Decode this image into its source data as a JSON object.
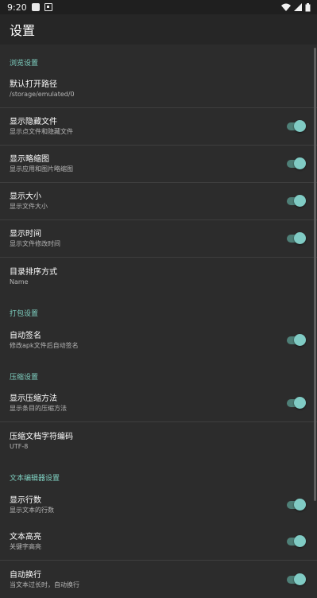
{
  "status_bar": {
    "time": "9:20",
    "icons": [
      "app-icon",
      "a-notification-icon",
      "wifi-icon",
      "cellular-icon",
      "battery-icon"
    ]
  },
  "app_bar": {
    "title": "设置"
  },
  "sections": {
    "browse": {
      "header": "浏览设置",
      "items": [
        {
          "title": "默认打开路径",
          "subtitle": "/storage/emulated/0"
        },
        {
          "title": "显示隐藏文件",
          "subtitle": "显示点文件和隐藏文件",
          "toggle": true
        },
        {
          "title": "显示略缩图",
          "subtitle": "显示应用和图片略缩图",
          "toggle": true
        },
        {
          "title": "显示大小",
          "subtitle": "显示文件大小",
          "toggle": true
        },
        {
          "title": "显示时间",
          "subtitle": "显示文件修改时间",
          "toggle": true
        },
        {
          "title": "目录排序方式",
          "subtitle": "Name"
        }
      ]
    },
    "package": {
      "header": "打包设置",
      "items": [
        {
          "title": "自动签名",
          "subtitle": "修改apk文件后自动签名",
          "toggle": true
        }
      ]
    },
    "compress": {
      "header": "压缩设置",
      "items": [
        {
          "title": "显示压缩方法",
          "subtitle": "显示条目的压缩方法",
          "toggle": true
        },
        {
          "title": "压缩文档字符编码",
          "subtitle": "UTF-8"
        }
      ]
    },
    "editor": {
      "header": "文本编辑器设置",
      "items": [
        {
          "title": "显示行数",
          "subtitle": "显示文本的行数",
          "toggle": true
        },
        {
          "title": "文本高亮",
          "subtitle": "关键字高亮",
          "toggle": true
        },
        {
          "title": "自动换行",
          "subtitle": "当文本过长时，自动换行",
          "toggle": true
        }
      ]
    }
  },
  "colors": {
    "background": "#2c2c2c",
    "accent": "#80cbc4",
    "section_header": "#7fd1c2",
    "switch_track": "#4e7f77"
  }
}
